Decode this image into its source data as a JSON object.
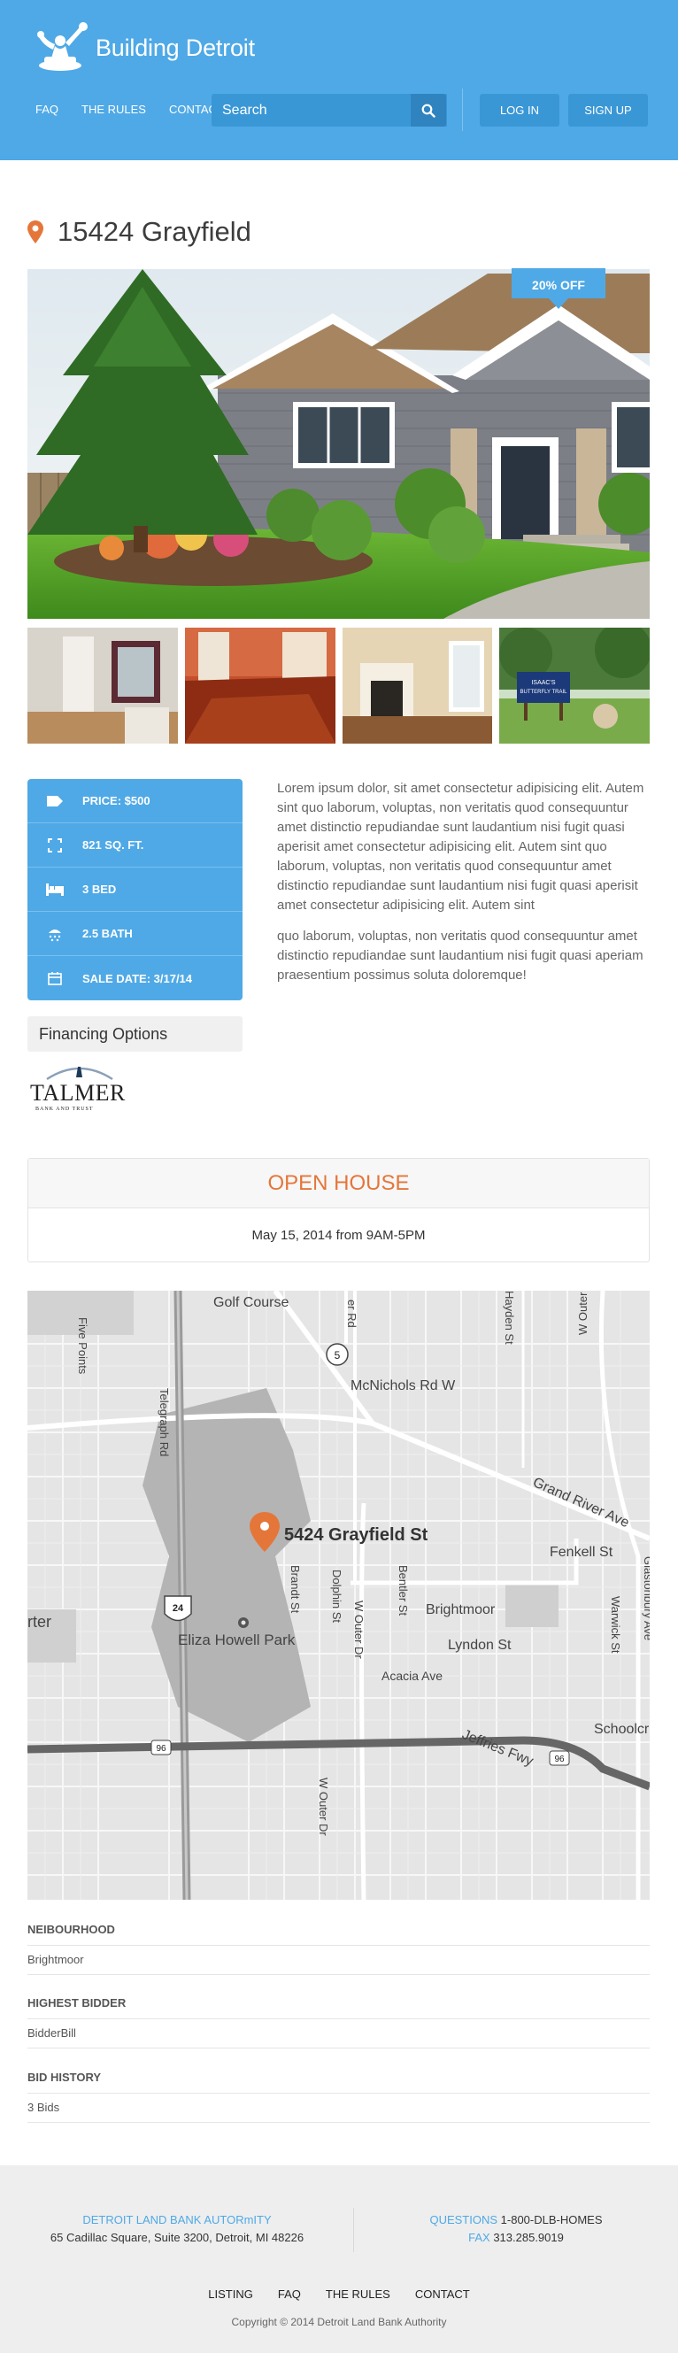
{
  "header": {
    "logo_text": "Building Detroit",
    "nav": [
      "FAQ",
      "THE RULES",
      "CONTACT"
    ],
    "search_placeholder": "Search",
    "login": "LOG IN",
    "signup": "SIGN UP"
  },
  "listing": {
    "address": "15424 Grayfield",
    "badge": "20% OFF",
    "sign_text": "ISAAC'S BUTTERFLY TRAIL",
    "specs": {
      "price": "PRICE: $500",
      "sqft": "821 SQ. FT.",
      "bed": "3 BED",
      "bath": "2.5 BATH",
      "sale": "SALE DATE: 3/17/14"
    },
    "financing": "Financing Options",
    "lender_name": "TALMER",
    "lender_sub": "BANK AND TRUST",
    "description": [
      "Lorem ipsum dolor, sit amet consectetur adipisicing elit. Autem sint quo laborum, voluptas, non veritatis quod consequuntur amet distinctio repudiandae sunt laudantium nisi fugit quasi aperisit amet consectetur adipisicing elit. Autem sint quo laborum, voluptas, non veritatis quod consequuntur amet distinctio repudiandae sunt laudantium nisi fugit quasi aperisit amet consectetur adipisicing elit. Autem sint",
      "quo laborum, voluptas, non veritatis quod consequuntur amet distinctio repudiandae sunt laudantium nisi fugit quasi aperiam praesentium possimus soluta doloremque!"
    ]
  },
  "open_house": {
    "title": "OPEN HOUSE",
    "when": "May 15, 2014 from 9AM-5PM"
  },
  "map": {
    "marker_label": "5424 Grayfield St",
    "labels": {
      "golf": "Golf Course",
      "mcnichols": "McNichols Rd W",
      "grand_river": "Grand River Ave",
      "fenkell": "Fenkell St",
      "brightmoor": "Brightmoor",
      "lyndon": "Lyndon St",
      "acacia": "Acacia Ave",
      "eliza": "Eliza Howell Park",
      "schoolcraft": "Schoolcr",
      "jeffries": "Jeffries Fwy",
      "telegraph": "Telegraph Rd",
      "five_points": "Five Points",
      "w_outer_dr": "W Outer Dr",
      "w_outer_dr_2": "W Outer Dr",
      "dolphin": "Dolphin St",
      "bentler": "Bentler St",
      "brandt": "Brandt St",
      "hayden": "Hayden St",
      "outer_dr_ne": "W Outer Dr",
      "warwick": "Warwick St",
      "glastonbury": "Glastonbury Ave",
      "telegraph_top": "Telegraph Rd",
      "rd_top": "er Rd",
      "arter": "rter",
      "shield_5": "5",
      "shield_24": "24",
      "shield_96a": "96",
      "shield_96b": "96"
    }
  },
  "info": {
    "neighbourhood_label": "NEIBOURHOOD",
    "neighbourhood_value": "Brightmoor",
    "bidder_label": "HIGHEST BIDDER",
    "bidder_value": "BidderBill",
    "history_label": "BID HISTORY",
    "history_value": "3 Bids"
  },
  "footer": {
    "org": "DETROIT LAND BANK AUTORmITY",
    "address": "65 Cadillac Square, Suite 3200, Detroit, MI 48226",
    "questions_label": "QUESTIONS",
    "questions_value": "1-800-DLB-HOMES",
    "fax_label": "FAX",
    "fax_value": "313.285.9019",
    "nav": [
      "LISTING",
      "FAQ",
      "THE RULES",
      "CONTACT"
    ],
    "copyright": "Copyright © 2014 Detroit Land Bank Authority"
  },
  "colors": {
    "brand_blue": "#4fa9e6",
    "accent_orange": "#e5763a"
  }
}
